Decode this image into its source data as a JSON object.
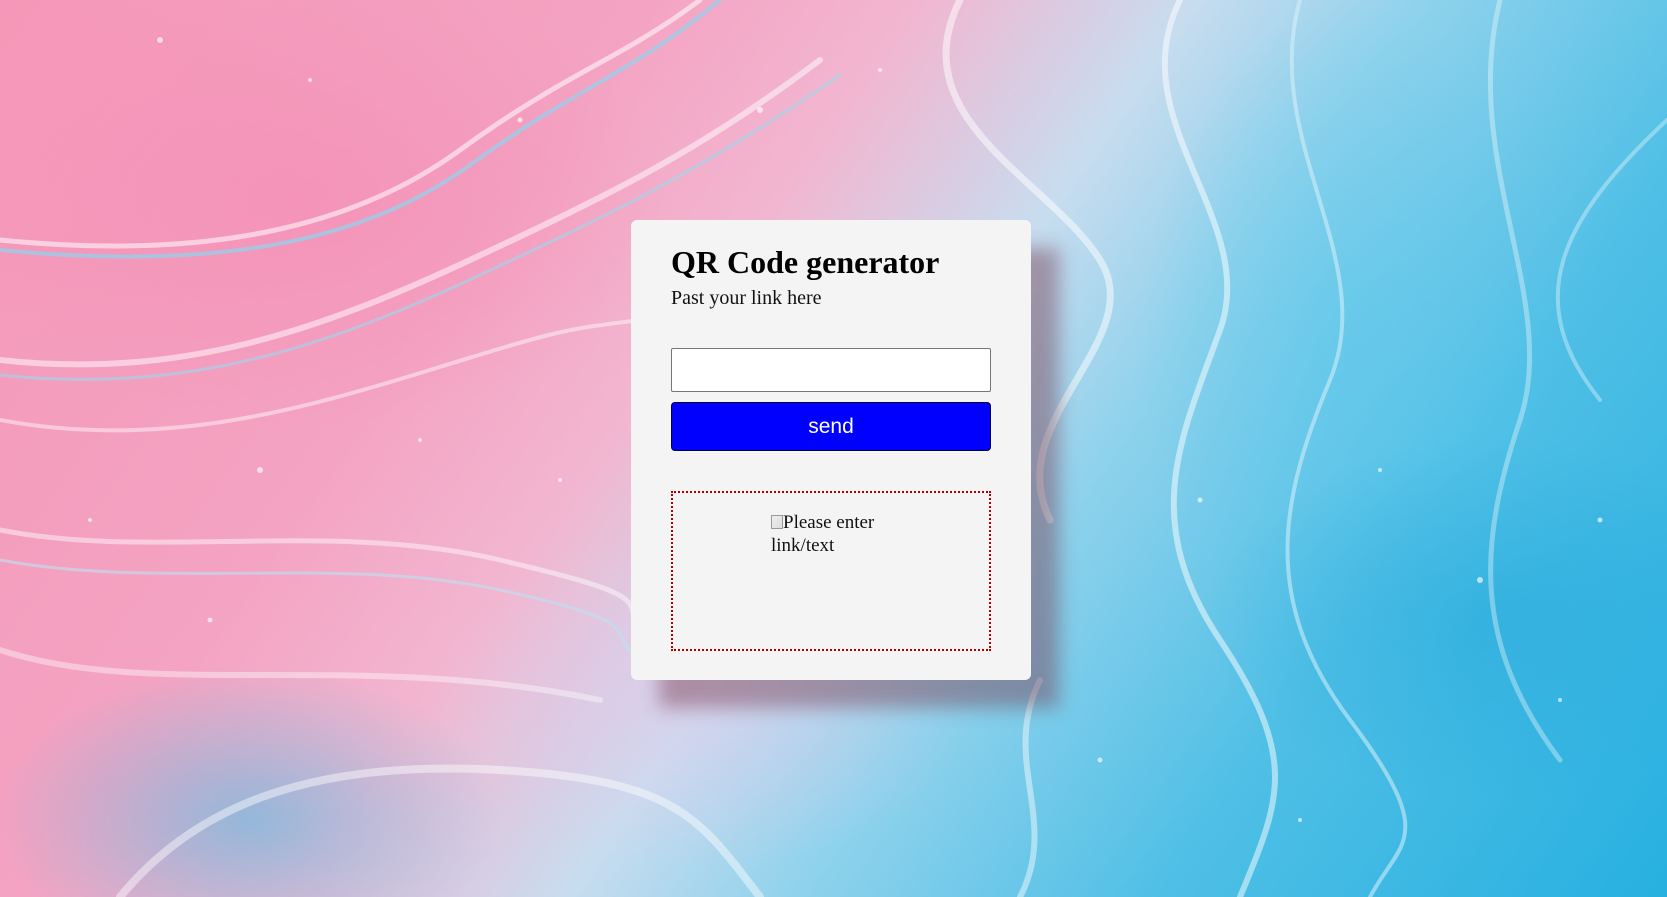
{
  "app": {
    "title": "QR Code generator",
    "subtitle": "Past your link here"
  },
  "form": {
    "link_value": "",
    "link_placeholder": "",
    "send_label": "send"
  },
  "result": {
    "alt_text": "Please enter link/text",
    "border_color": "#b00000"
  },
  "colors": {
    "button": "#0000ff",
    "card": "#f4f4f4"
  }
}
